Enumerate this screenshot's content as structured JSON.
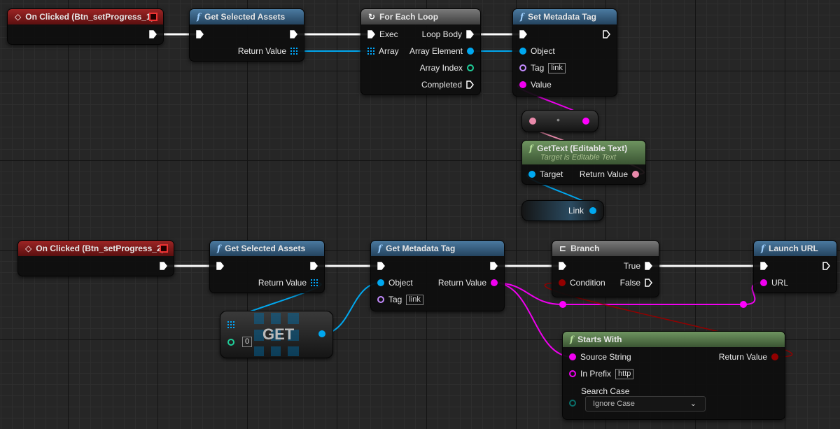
{
  "colors": {
    "exec": "#ffffff",
    "object": "#00a8f0",
    "string": "#f000f0",
    "text": "#e889aa",
    "bool": "#930000",
    "int": "#1fcf9a",
    "name": "#c48cff",
    "byte": "#0a6f6a"
  },
  "icons": {
    "event": "event-diamond-icon",
    "function": "function-f-icon",
    "loop": "loop-icon",
    "branch": "branch-icon",
    "array": "array-grid-icon",
    "stop": "stop-square-icon"
  },
  "nodes": [
    {
      "id": "oc1",
      "kind": "ev",
      "title": "On Clicked (Btn_setProgress_1)",
      "pins": [
        {
          "k": "eo",
          "side": "r",
          "type": "exec",
          "row": 0
        }
      ]
    },
    {
      "id": "gsa1",
      "kind": "fn",
      "title": "Get Selected Assets",
      "pins": [
        {
          "k": "ei",
          "side": "l",
          "type": "exec",
          "row": 0
        },
        {
          "k": "eo",
          "side": "r",
          "type": "exec",
          "row": 0
        },
        {
          "k": "ret",
          "side": "r",
          "type": "array",
          "label": "Return Value",
          "row": 1
        }
      ]
    },
    {
      "id": "fel",
      "kind": "gray",
      "icon": "loop",
      "title": "For Each Loop",
      "pins": [
        {
          "k": "ei",
          "side": "l",
          "type": "exec",
          "label": "Exec",
          "row": 0
        },
        {
          "k": "arr",
          "side": "l",
          "type": "array",
          "label": "Array",
          "row": 1
        },
        {
          "k": "body",
          "side": "r",
          "type": "exec",
          "label": "Loop Body",
          "row": 0
        },
        {
          "k": "el",
          "side": "r",
          "type": "object",
          "label": "Array Element",
          "row": 1
        },
        {
          "k": "idx",
          "side": "r",
          "type": "int",
          "hollow": true,
          "label": "Array Index",
          "row": 2
        },
        {
          "k": "done",
          "side": "r",
          "type": "exec",
          "hollow": true,
          "label": "Completed",
          "row": 3
        }
      ]
    },
    {
      "id": "smt",
      "kind": "fn",
      "title": "Set Metadata Tag",
      "pins": [
        {
          "k": "ei",
          "side": "l",
          "type": "exec",
          "row": 0
        },
        {
          "k": "eo",
          "side": "r",
          "type": "exec",
          "hollow": true,
          "row": 0
        },
        {
          "k": "obj",
          "side": "l",
          "type": "object",
          "label": "Object",
          "row": 1
        },
        {
          "k": "tag",
          "side": "l",
          "type": "name",
          "hollow": true,
          "label": "Tag",
          "def": "link",
          "row": 2
        },
        {
          "k": "val",
          "side": "l",
          "type": "string",
          "label": "Value",
          "row": 3
        }
      ]
    },
    {
      "id": "gt",
      "kind": "pure",
      "title": "GetText (Editable Text)",
      "subtitle": "Target is Editable Text",
      "pins": [
        {
          "k": "tgt",
          "side": "l",
          "type": "object",
          "label": "Target",
          "row": 0
        },
        {
          "k": "ret",
          "side": "r",
          "type": "text",
          "label": "Return Value",
          "row": 0
        }
      ]
    },
    {
      "id": "oc2",
      "kind": "ev",
      "title": "On Clicked (Btn_setProgress_2)",
      "pins": [
        {
          "k": "eo",
          "side": "r",
          "type": "exec",
          "row": 0
        }
      ]
    },
    {
      "id": "gsa2",
      "kind": "fn",
      "title": "Get Selected Assets",
      "pins": [
        {
          "k": "ei",
          "side": "l",
          "type": "exec",
          "row": 0
        },
        {
          "k": "eo",
          "side": "r",
          "type": "exec",
          "row": 0
        },
        {
          "k": "ret",
          "side": "r",
          "type": "array",
          "label": "Return Value",
          "row": 1
        }
      ]
    },
    {
      "id": "gmt",
      "kind": "fn",
      "title": "Get Metadata Tag",
      "pins": [
        {
          "k": "ei",
          "side": "l",
          "type": "exec",
          "row": 0
        },
        {
          "k": "eo",
          "side": "r",
          "type": "exec",
          "row": 0
        },
        {
          "k": "obj",
          "side": "l",
          "type": "object",
          "label": "Object",
          "row": 1
        },
        {
          "k": "tag",
          "side": "l",
          "type": "name",
          "hollow": true,
          "label": "Tag",
          "def": "link",
          "row": 2
        },
        {
          "k": "ret",
          "side": "r",
          "type": "string",
          "label": "Return Value",
          "row": 1
        }
      ]
    },
    {
      "id": "br",
      "kind": "gray",
      "icon": "branch",
      "title": "Branch",
      "pins": [
        {
          "k": "ei",
          "side": "l",
          "type": "exec",
          "row": 0
        },
        {
          "k": "cond",
          "side": "l",
          "type": "bool",
          "label": "Condition",
          "row": 1
        },
        {
          "k": "t",
          "side": "r",
          "type": "exec",
          "label": "True",
          "row": 0
        },
        {
          "k": "f",
          "side": "r",
          "type": "exec",
          "hollow": true,
          "label": "False",
          "row": 1
        }
      ]
    },
    {
      "id": "lu",
      "kind": "fn",
      "title": "Launch URL",
      "pins": [
        {
          "k": "ei",
          "side": "l",
          "type": "exec",
          "row": 0
        },
        {
          "k": "eo",
          "side": "r",
          "type": "exec",
          "hollow": true,
          "row": 0
        },
        {
          "k": "url",
          "side": "l",
          "type": "string",
          "label": "URL",
          "row": 1
        }
      ]
    },
    {
      "id": "sw",
      "kind": "pure",
      "title": "Starts With",
      "pins": [
        {
          "k": "src",
          "side": "l",
          "type": "string",
          "label": "Source String",
          "row": 0
        },
        {
          "k": "pre",
          "side": "l",
          "type": "string",
          "hollow": true,
          "label": "In Prefix",
          "def": "http",
          "row": 1
        },
        {
          "k": "ret",
          "side": "r",
          "type": "bool",
          "label": "Return Value",
          "row": 0
        }
      ]
    }
  ],
  "conversion_node": {
    "label": "•"
  },
  "link_variable": {
    "label": "Link"
  },
  "get_node": {
    "label": "GET",
    "index_default": "0"
  },
  "starts_with_search_case": {
    "label": "Search Case",
    "selected": "Ignore Case"
  },
  "connections": [
    [
      "oc1.eo",
      "gsa1.ei",
      "exec"
    ],
    [
      "gsa1.eo",
      "fel.ei",
      "exec"
    ],
    [
      "gsa1.ret",
      "fel.arr",
      "object"
    ],
    [
      "fel.body",
      "smt.ei",
      "exec"
    ],
    [
      "fel.el",
      "smt.obj",
      "object"
    ],
    [
      "conv.out",
      "smt.val",
      "string"
    ],
    [
      "gt.ret",
      "conv.in",
      "text"
    ],
    [
      "link.out",
      "gt.tgt",
      "object"
    ],
    [
      "oc2.eo",
      "gsa2.ei",
      "exec"
    ],
    [
      "gsa2.eo",
      "gmt.ei",
      "exec"
    ],
    [
      "gsa2.ret",
      "get.arr",
      "object"
    ],
    [
      "get.out",
      "gmt.obj",
      "object"
    ],
    [
      "gmt.eo",
      "br.ei",
      "exec"
    ],
    [
      "br.t",
      "lu.ei",
      "exec"
    ],
    [
      "gmt.ret",
      "k1.p",
      "string"
    ],
    [
      "k1.p",
      "k2.p",
      "string"
    ],
    [
      "k2.p",
      "lu.url",
      "string"
    ],
    [
      "gmt.ret",
      "sw.src",
      "string"
    ],
    [
      "sw.ret",
      "br.cond",
      "bool"
    ]
  ]
}
